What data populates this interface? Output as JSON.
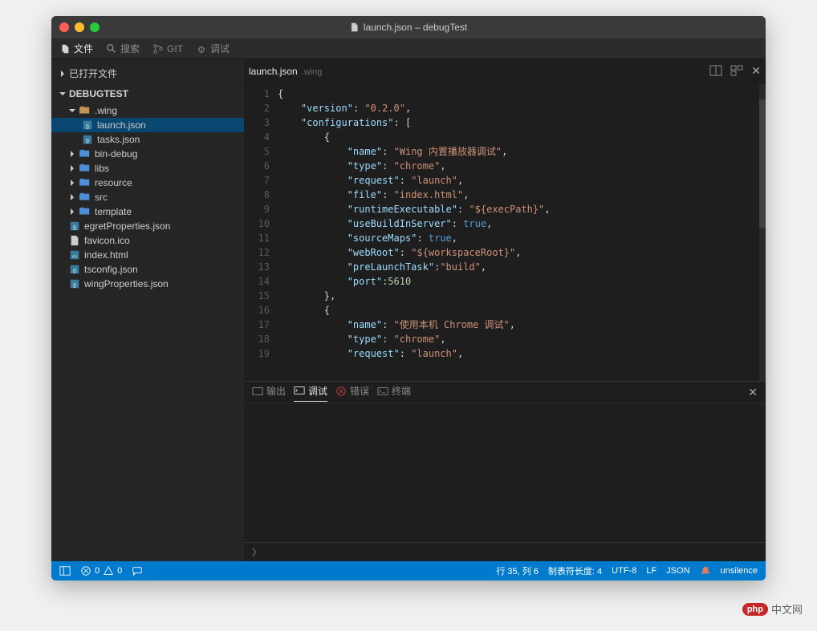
{
  "titlebar": {
    "title": "launch.json – debugTest"
  },
  "topbar": {
    "file": "文件",
    "search": "搜索",
    "git": "GIT",
    "debug": "调试"
  },
  "sidebar": {
    "opened_files": "已打开文件",
    "project": "DEBUGTEST",
    "tree": {
      "wing": ".wing",
      "launch": "launch.json",
      "tasks": "tasks.json",
      "bin_debug": "bin-debug",
      "libs": "libs",
      "resource": "resource",
      "src": "src",
      "template": "template",
      "egret": "egretProperties.json",
      "favicon": "favicon.ico",
      "index": "index.html",
      "tsconfig": "tsconfig.json",
      "wingprop": "wingProperties.json"
    }
  },
  "tab": {
    "name": "launch.json",
    "dir": ".wing"
  },
  "code": {
    "version_key": "\"version\"",
    "version_val": "\"0.2.0\"",
    "configs_key": "\"configurations\"",
    "name_key": "\"name\"",
    "name_val1": "\"Wing 内置播放器调试\"",
    "type_key": "\"type\"",
    "type_val": "\"chrome\"",
    "request_key": "\"request\"",
    "request_val": "\"launch\"",
    "file_key": "\"file\"",
    "file_val": "\"index.html\"",
    "runtime_key": "\"runtimeExecutable\"",
    "runtime_val": "\"${execPath}\"",
    "usebuild_key": "\"useBuildInServer\"",
    "sourcemaps_key": "\"sourceMaps\"",
    "true_val": "true",
    "webroot_key": "\"webRoot\"",
    "webroot_val": "\"${workspaceRoot}\"",
    "prelaunch_key": "\"preLaunchTask\"",
    "prelaunch_val": "\"build\"",
    "port_key": "\"port\"",
    "port_val": "5610",
    "name_val2": "\"使用本机 Chrome 调试\""
  },
  "panel": {
    "output": "输出",
    "debug": "调试",
    "errors": "错误",
    "terminal": "终端",
    "prompt": "〉"
  },
  "status": {
    "errors": "0",
    "warnings": "0",
    "cursor": "行 35, 列 6",
    "tabsize": "制表符长度: 4",
    "encoding": "UTF-8",
    "eol": "LF",
    "lang": "JSON",
    "user": "unsilence"
  },
  "watermark": {
    "badge": "php",
    "text": "中文网"
  }
}
